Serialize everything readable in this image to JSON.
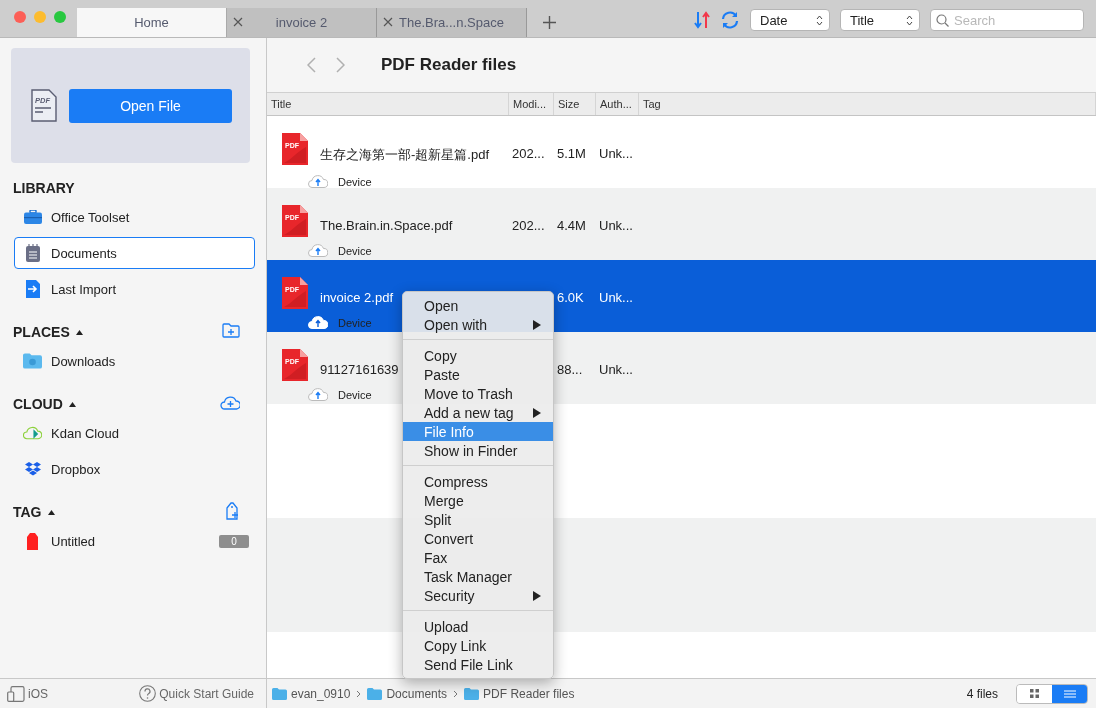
{
  "tabs": [
    {
      "label": "Home",
      "selected": true,
      "closable": false
    },
    {
      "label": "invoice 2",
      "selected": false,
      "closable": true
    },
    {
      "label": "The.Bra...n.Space",
      "selected": false,
      "closable": true
    }
  ],
  "toolbar": {
    "sort_field": "Date",
    "sort_by": "Title",
    "search": {
      "placeholder": "Search"
    }
  },
  "sidebar": {
    "open_icon_text": "PDF",
    "open_button": "Open File",
    "sections": [
      {
        "title": "LIBRARY",
        "items": [
          {
            "label": "Office Toolset",
            "selected": false
          },
          {
            "label": "Documents",
            "selected": true
          },
          {
            "label": "Last Import",
            "selected": false
          }
        ]
      },
      {
        "title": "PLACES",
        "expanded": true,
        "items": [
          {
            "label": "Downloads",
            "selected": false
          }
        ]
      },
      {
        "title": "CLOUD",
        "expanded": true,
        "items": [
          {
            "label": "Kdan Cloud",
            "selected": false
          },
          {
            "label": "Dropbox",
            "selected": false
          }
        ]
      },
      {
        "title": "TAG",
        "expanded": true,
        "items": [
          {
            "label": "Untitled",
            "selected": false,
            "count": "0",
            "color": "#ff2020"
          }
        ]
      }
    ],
    "footer": {
      "device": "iOS",
      "guide": "Quick Start Guide"
    }
  },
  "content": {
    "title": "PDF Reader files",
    "columns": [
      "Title",
      "Modi...",
      "Size",
      "Auth...",
      "Tag"
    ],
    "rows": [
      {
        "icon_text": "PDF",
        "title": "生存之海第一部-超新星篇.pdf",
        "modified": "202...",
        "size": "5.1M",
        "author": "Unk...",
        "location": "Device",
        "selected": false
      },
      {
        "icon_text": "PDF",
        "title": "The.Brain.in.Space.pdf",
        "modified": "202...",
        "size": "4.4M",
        "author": "Unk...",
        "location": "Device",
        "selected": false
      },
      {
        "icon_text": "PDF",
        "title": "invoice 2.pdf",
        "size": "6.0K",
        "author": "Unk...",
        "location": "Device",
        "selected": true
      },
      {
        "icon_text": "PDF",
        "title": "91127161639",
        "size": "88...",
        "author": "Unk...",
        "location": "Device",
        "selected": false
      }
    ]
  },
  "context_menu": [
    [
      {
        "label": "Open",
        "selected": false,
        "submenu": false
      },
      {
        "label": "Open with",
        "selected": false,
        "submenu": true
      }
    ],
    [
      {
        "label": "Copy",
        "selected": false,
        "submenu": false
      },
      {
        "label": "Paste",
        "selected": false,
        "submenu": false
      },
      {
        "label": "Move to Trash",
        "selected": false,
        "submenu": false
      },
      {
        "label": "Add a new tag",
        "selected": false,
        "submenu": true
      },
      {
        "label": "File Info",
        "selected": true,
        "submenu": false
      },
      {
        "label": "Show in Finder",
        "selected": false,
        "submenu": false
      }
    ],
    [
      {
        "label": "Compress",
        "selected": false,
        "submenu": false
      },
      {
        "label": "Merge",
        "selected": false,
        "submenu": false
      },
      {
        "label": "Split",
        "selected": false,
        "submenu": false
      },
      {
        "label": "Convert",
        "selected": false,
        "submenu": false
      },
      {
        "label": "Fax",
        "selected": false,
        "submenu": false
      },
      {
        "label": "Task Manager",
        "selected": false,
        "submenu": false
      },
      {
        "label": "Security",
        "selected": false,
        "submenu": true
      }
    ],
    [
      {
        "label": "Upload",
        "selected": false,
        "submenu": false
      },
      {
        "label": "Copy Link",
        "selected": false,
        "submenu": false
      },
      {
        "label": "Send File Link",
        "selected": false,
        "submenu": false
      }
    ]
  ],
  "status_bar": {
    "breadcrumbs": [
      "evan_0910",
      "Documents",
      "PDF Reader files"
    ],
    "count": "4 files",
    "views": [
      {
        "kind": "grid",
        "selected": false
      },
      {
        "kind": "list",
        "selected": true
      }
    ]
  }
}
